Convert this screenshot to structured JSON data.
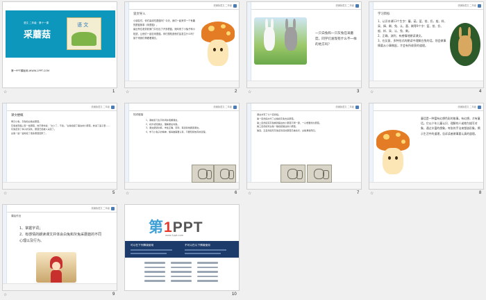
{
  "header_text": "统编版语文 二年级",
  "slides": [
    {
      "number": "1",
      "subtitle": "语文 二年级 · 第十一课",
      "title": "采蘑菇",
      "book_label": "语 文",
      "footer": "第一PPT模板网-WWW.1PPT.COM"
    },
    {
      "number": "2",
      "heading": "谈文导入",
      "body": [
        "小朋友们，你们喜欢吃蘑菇吗？今天，我们一起来学一个有趣的蘑菇故事《采蘑菇》。",
        "最近有位老奶奶家门口长出了许多蘑菇，她叫来了小兔子和小松鼠，让他们一起去采蘑菇。你们想知道他们会发生什么吗？",
        "接下来我们再看看课文。"
      ]
    },
    {
      "number": "3",
      "text": "一只白兔和一只灰兔在采蘑菇，同学们发现有什么不一样的地方吗？"
    },
    {
      "number": "4",
      "heading": "学习目标",
      "items": [
        "1、认识本课13个生字：蘑、菇、篮、拾、扔、般、样、采、捧、剩、兔、认、喜、剩等9个字：篮、拾、扔、般、样、采、认、兔、剩。",
        "2、正确、流利、有感情地朗读课文。",
        "3、在反复、多种形式的朗读中理解白兔的话。领会做事情要从小事做起，才会有所收获的道理。"
      ]
    },
    {
      "number": "5",
      "heading": "课文梗概",
      "body": [
        "两只小兔，灰兔和白兔采蘑菇。",
        "灰兔发现路上有一些蘑菇，他不屑地说：“太少了，不捡。”白兔捡起了路边的小蘑菇，放进了篮子里……",
        "灰兔走到了林子的深处，蘑菇已经被人采走了。",
        "白兔一篮一篮地捡了很多蘑菇回家了。"
      ]
    },
    {
      "number": "6",
      "heading": "知识链接",
      "items": [
        "1、课前复习生字新词并把握课文。",
        "2、初步感知课文，理解课文内容。",
        "3、课文朗读训练，学会正确、流利、有感情地朗读课文。",
        "4、学习小兔子的精神，懂得做事要认真，不要轻易放弃的道理。"
      ]
    },
    {
      "number": "7",
      "items": [
        "课文共写了七个自然段。",
        "第一自然段交代了白兔和灰兔去采蘑菇。",
        "第二自然段写灰兔看到路边的小蘑菇不屑一顾，一心想要找大蘑菇。",
        "第三自然段写白兔一路捡起路边的小蘑菇。",
        "第四、五自然段写灰兔走到深处蘑菇已被采光，白兔满载而归。"
      ]
    },
    {
      "number": "8",
      "text": "童话是一种富有幻想色彩的故事。有幻想，才有童话。它以少年儿童认识、理解的人或物为描写对象，通过丰富的想象，夸张的手法来塑造形象，揭示生活中的道理，告诉读者做事要认真的道理。"
    },
    {
      "number": "9",
      "heading": "课后作业",
      "items": [
        "1、掌握字词；",
        "2、有感情的朗读课文并体会白兔和灰兔采蘑菇的不同心理以及行为。"
      ]
    },
    {
      "number": "10",
      "logo_prefix": "第",
      "logo_digit": "1",
      "logo_suffix": "PPT",
      "logo_domain": "www.1ppt.com",
      "left_box": "可以在下列情境使用",
      "right_box": "不可以在以下情境使用"
    }
  ],
  "colors": {
    "accent": "#0e97bd",
    "mushroom_cap": "#e47c25",
    "footer_blue": "#1c3b6a"
  }
}
